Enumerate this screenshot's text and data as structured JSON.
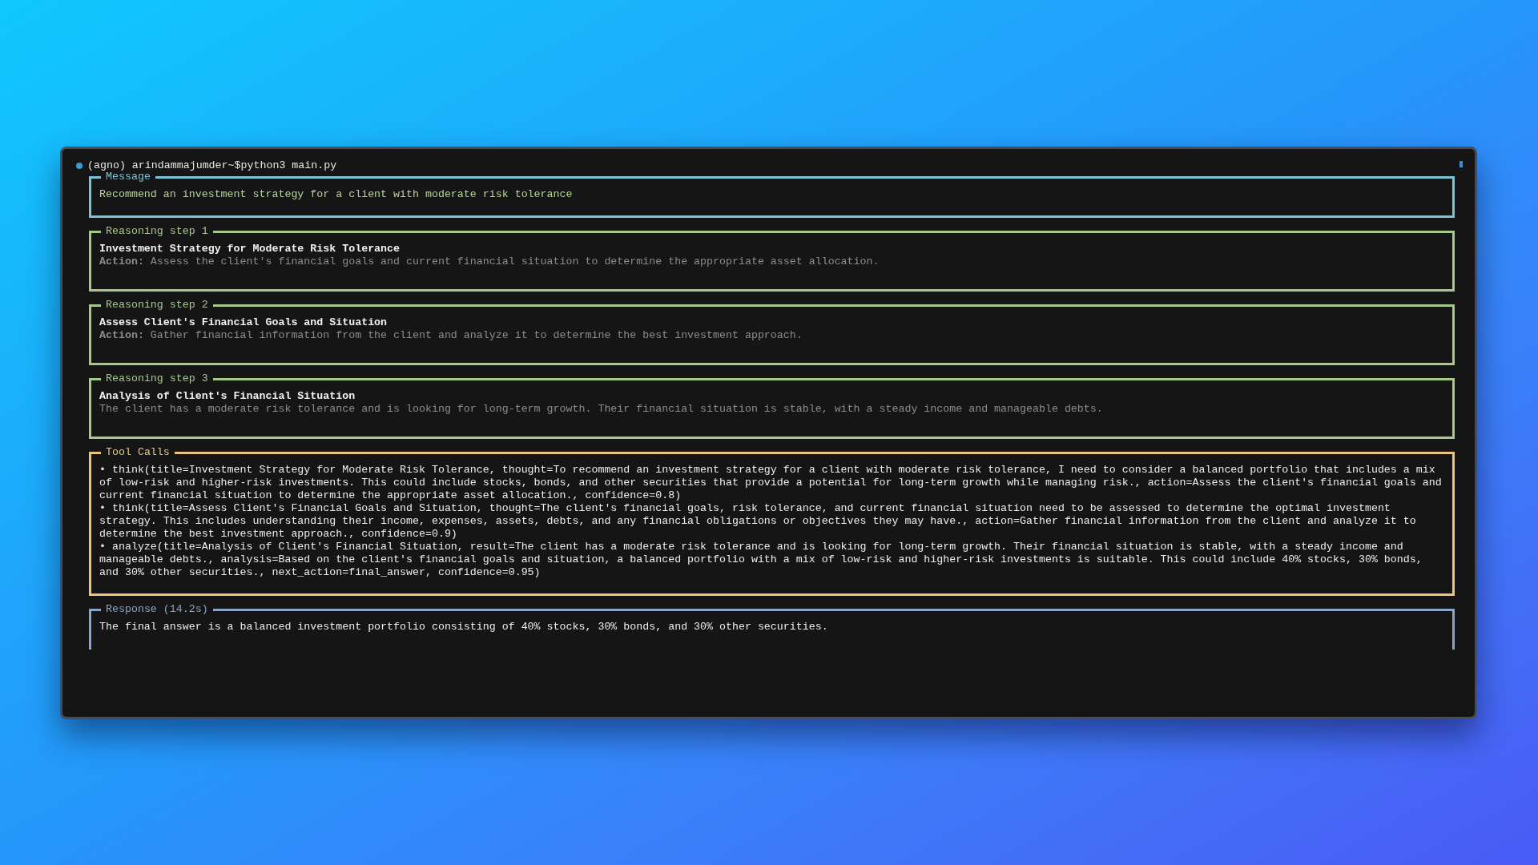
{
  "terminal": {
    "prompt": "(agno) arindammajumder~$python3 main.py"
  },
  "panels": [
    {
      "kind": "message",
      "title": "Message",
      "text": "Recommend an investment strategy for a client with moderate risk tolerance"
    },
    {
      "kind": "step",
      "title": "Reasoning step 1",
      "heading": "Investment Strategy for Moderate Risk Tolerance",
      "body": "**Action:** Assess the client's financial goals and current financial situation to determine the appropriate asset allocation."
    },
    {
      "kind": "step",
      "title": "Reasoning step 2",
      "heading": "Assess Client's Financial Goals and Situation",
      "body": "**Action:** Gather financial information from the client and analyze it to determine the best investment approach."
    },
    {
      "kind": "step",
      "title": "Reasoning step 3",
      "heading": "Analysis of Client's Financial Situation",
      "body": "The client has a moderate risk tolerance and is looking for long-term growth. Their financial situation is stable, with a steady income and manageable debts."
    },
    {
      "kind": "tools",
      "title": "Tool Calls",
      "items": [
        "• think(title=Investment Strategy for Moderate Risk Tolerance, thought=To recommend an investment strategy for a client with moderate risk tolerance, I need to consider a balanced portfolio that includes a mix of low-risk and higher-risk investments. This could include stocks, bonds, and other securities that provide a potential for long-term growth while managing risk., action=Assess the client's financial goals and current financial situation to determine the appropriate asset allocation., confidence=0.8)",
        "• think(title=Assess Client's Financial Goals and Situation, thought=The client's financial goals, risk tolerance, and current financial situation need to be assessed to determine the optimal investment strategy. This includes understanding their income, expenses, assets, debts, and any financial obligations or objectives they may have., action=Gather financial information from the client and analyze it to determine the best investment approach., confidence=0.9)",
        "• analyze(title=Analysis of Client's Financial Situation, result=The client has a moderate risk tolerance and is looking for long-term growth. Their financial situation is stable, with a steady income and manageable debts., analysis=Based on the client's financial goals and situation, a balanced portfolio with a mix of low-risk and higher-risk investments is suitable. This could include 40% stocks, 30% bonds, and 30% other securities., next_action=final_answer, confidence=0.95)"
      ]
    },
    {
      "kind": "response",
      "title": "Response (14.2s)",
      "text": "The final answer is a balanced investment portfolio consisting of 40% stocks, 30% bonds, and 30% other securities."
    }
  ]
}
